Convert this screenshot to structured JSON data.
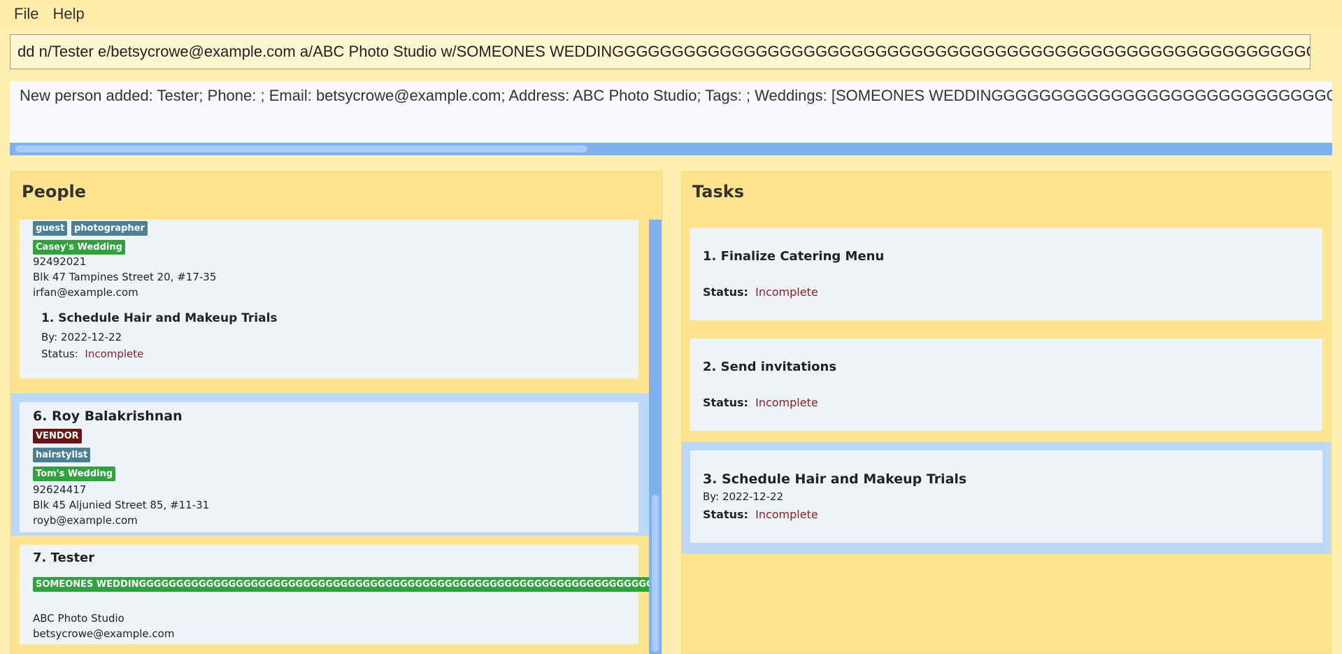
{
  "menu": {
    "file": "File",
    "help": "Help"
  },
  "command": {
    "value": "dd n/Tester e/betsycrowe@example.com a/ABC Photo Studio w/SOMEONES WEDDINGGGGGGGGGGGGGGGGGGGGGGGGGGGGGGGGGGGGGGGGGGGGGGGGGGGGGGGGGGGGGGGGGGGGGGGGGG"
  },
  "result": {
    "text": "New person added: Tester; Phone: ; Email: betsycrowe@example.com; Address: ABC Photo Studio; Tags: ; Weddings: [SOMEONES WEDDINGGGGGGGGGGGGGGGGGGGGGGGGGGGGGGGGGGGGGG"
  },
  "people": {
    "title": "People",
    "cards": [
      {
        "tags": [
          "guest",
          "photographer"
        ],
        "wedding": "Casey's Wedding",
        "phone": "92492021",
        "address": "Blk 47 Tampines Street 20, #17-35",
        "email": "irfan@example.com",
        "task": {
          "title": "1.  Schedule Hair and Makeup Trials",
          "by_label": "By:",
          "by_value": "2022-12-22",
          "status_label": "Status:",
          "status_value": "Incomplete"
        }
      },
      {
        "name": "6. Roy Balakrishnan",
        "role": "VENDOR",
        "tags": [
          "hairstylist"
        ],
        "wedding": "Tom's Wedding",
        "phone": "92624417",
        "address": "Blk 45 Aljunied Street 85, #11-31",
        "email": "royb@example.com"
      },
      {
        "name": "7. Tester",
        "wedding": "SOMEONES WEDDINGGGGGGGGGGGGGGGGGGGGGGGGGGGGGGGGGGGGGGGGGGGGGGGGGGGGGGGGGGGGGGGGGGGGGGG",
        "address": "ABC Photo Studio",
        "email": "betsycrowe@example.com"
      }
    ]
  },
  "tasks": {
    "title": "Tasks",
    "items": [
      {
        "title": "1. Finalize Catering Menu",
        "status_label": "Status:",
        "status_value": "Incomplete"
      },
      {
        "title": "2. Send invitations",
        "status_label": "Status:",
        "status_value": "Incomplete"
      },
      {
        "title": "3. Schedule Hair and Makeup Trials",
        "by_label": "By:",
        "by_value": "2022-12-22",
        "status_label": "Status:",
        "status_value": "Incomplete"
      }
    ]
  },
  "colors": {
    "background": "#ffefaf",
    "panel": "#ffe48f",
    "selection": "#bcdaf8",
    "scrollbar": "#7fb1f2",
    "wedding_tag": "#2fa33b",
    "tag": "#4a7f96",
    "vendor_tag": "#6a1414",
    "incomplete": "#8c1f2a"
  }
}
